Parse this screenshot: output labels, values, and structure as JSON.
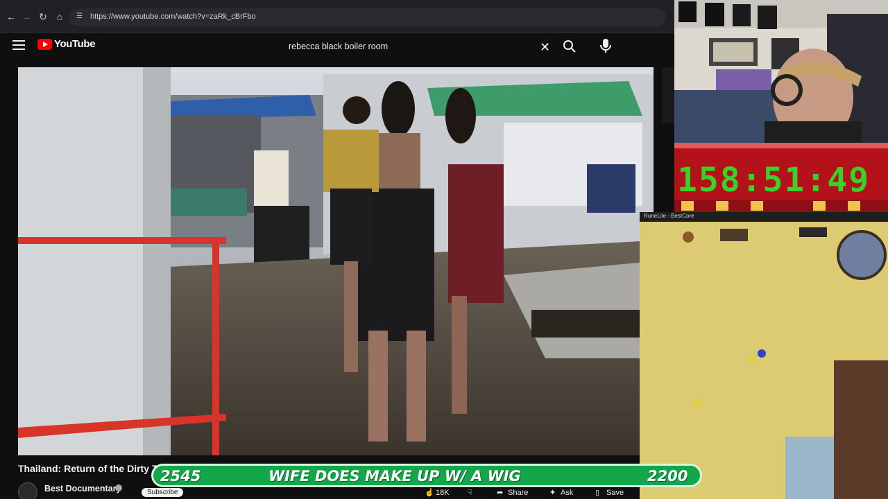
{
  "browser": {
    "url": "https://www.youtube.com/watch?v=zaRk_cBrFbo",
    "back_icon": "back-arrow-icon",
    "forward_icon": "forward-arrow-icon",
    "reload_icon": "reload-icon",
    "home_icon": "home-icon"
  },
  "header": {
    "logo_text": "YouTube",
    "search_query": "rebecca black boiler room"
  },
  "video": {
    "title": "Thailand: Return of the Dirty T",
    "channel": "Best Documentary",
    "subscribe_label": "Subscribe",
    "like_count": "18K",
    "share_label": "Share",
    "ask_label": "Ask",
    "save_label": "Save"
  },
  "timer": {
    "value": "158:51:49"
  },
  "game": {
    "title": "RuneLite - BestCore"
  },
  "banner": {
    "left_value": "2545",
    "message": "WIFE DOES MAKE UP W/ A WIG",
    "right_value": "2200"
  },
  "colors": {
    "page_bg": "#0f0f0f",
    "yt_red": "#ff0000",
    "timer_bg": "#b3121b",
    "timer_digits": "#39d12a",
    "banner_bg": "#14a64a"
  }
}
